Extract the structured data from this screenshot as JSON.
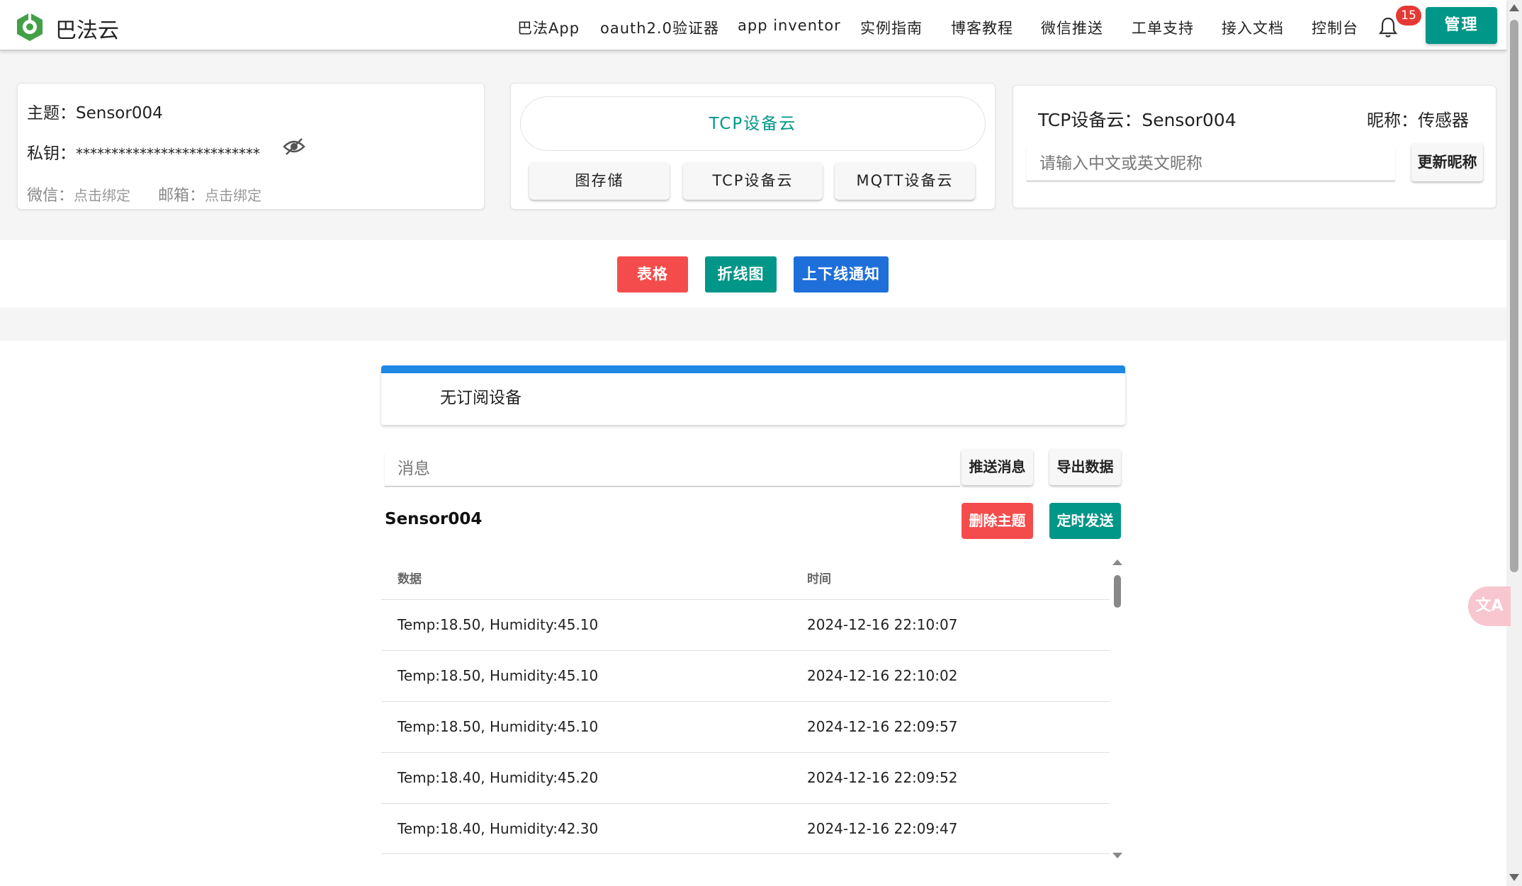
{
  "header": {
    "brand": "巴法云",
    "nav": [
      "巴法App",
      "oauth2.0验证器",
      "app inventor",
      "实例指南",
      "博客教程",
      "微信推送",
      "工单支持",
      "接入文档",
      "控制台"
    ],
    "notification_count": "15",
    "manage_label": "管理",
    "colors": {
      "accent": "#009688",
      "badge": "#e53935"
    }
  },
  "account": {
    "topic_label": "主题：",
    "topic_value": "Sensor004",
    "key_label": "私钥：",
    "key_value": "**************************",
    "wechat_label": "微信：",
    "wechat_value": "点击绑定",
    "email_label": "邮箱：",
    "email_value": "点击绑定"
  },
  "cloud": {
    "title": "TCP设备云",
    "buttons": [
      "图存储",
      "TCP设备云",
      "MQTT设备云"
    ]
  },
  "nickname": {
    "title": "TCP设备云：Sensor004",
    "nick_label": "昵称：传感器",
    "placeholder": "请输入中文或英文昵称",
    "update_label": "更新昵称"
  },
  "tabs": [
    {
      "label": "表格",
      "color": "#f44c4c"
    },
    {
      "label": "折线图",
      "color": "#009688"
    },
    {
      "label": "上下线通知",
      "color": "#1e6fd9"
    }
  ],
  "subscription": {
    "text": "无订阅设备"
  },
  "message": {
    "placeholder": "消息",
    "push_label": "推送消息",
    "export_label": "导出数据"
  },
  "topic": {
    "name": "Sensor004",
    "delete_label": "删除主题",
    "schedule_label": "定时发送"
  },
  "table": {
    "headers": [
      "数据",
      "时间"
    ],
    "rows": [
      [
        "Temp:18.50, Humidity:45.10",
        "2024-12-16 22:10:07"
      ],
      [
        "Temp:18.50, Humidity:45.10",
        "2024-12-16 22:10:02"
      ],
      [
        "Temp:18.50, Humidity:45.10",
        "2024-12-16 22:09:57"
      ],
      [
        "Temp:18.40, Humidity:45.20",
        "2024-12-16 22:09:52"
      ],
      [
        "Temp:18.40, Humidity:42.30",
        "2024-12-16 22:09:47"
      ]
    ]
  },
  "translate": {
    "label": "文A"
  }
}
